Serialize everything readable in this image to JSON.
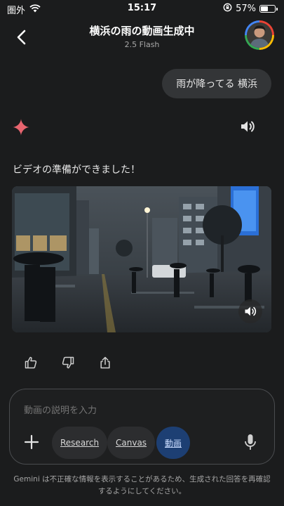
{
  "status_bar": {
    "carrier": "圏外",
    "time": "15:17",
    "battery_percent_text": "57%",
    "battery_level": 0.57,
    "icons": [
      "wifi-icon",
      "orientation-lock-icon",
      "battery-icon"
    ]
  },
  "header": {
    "title": "横浜の雨の動画生成中",
    "model": "2.5 Flash",
    "back_icon": "chevron-left-icon",
    "avatar_icon": "user-avatar"
  },
  "conversation": {
    "user_message": "雨が降ってる 横浜",
    "response_text": "ビデオの準備ができました！",
    "response_icons": [
      "gemini-spark-icon",
      "speaker-icon"
    ],
    "video": {
      "description": "Rainy night street in Yokohama with pedestrians holding umbrellas",
      "mute_icon": "speaker-icon"
    },
    "feedback_icons": [
      "thumbs-up-icon",
      "thumbs-down-icon",
      "share-icon"
    ]
  },
  "composer": {
    "placeholder": "動画の説明を入力",
    "tools": {
      "research": "Research",
      "canvas": "Canvas",
      "video": "動画"
    },
    "plus_icon": "plus-icon",
    "mic_icon": "microphone-icon"
  },
  "disclaimer": "Gemini は不正確な情報を表示することがあるため、生成された回答を再確認するようにしてください。",
  "colors": {
    "background": "#1b1c1d",
    "bubble": "#333537",
    "video_chip": "#1d3f73",
    "gemini_spark": "#e8656f"
  }
}
